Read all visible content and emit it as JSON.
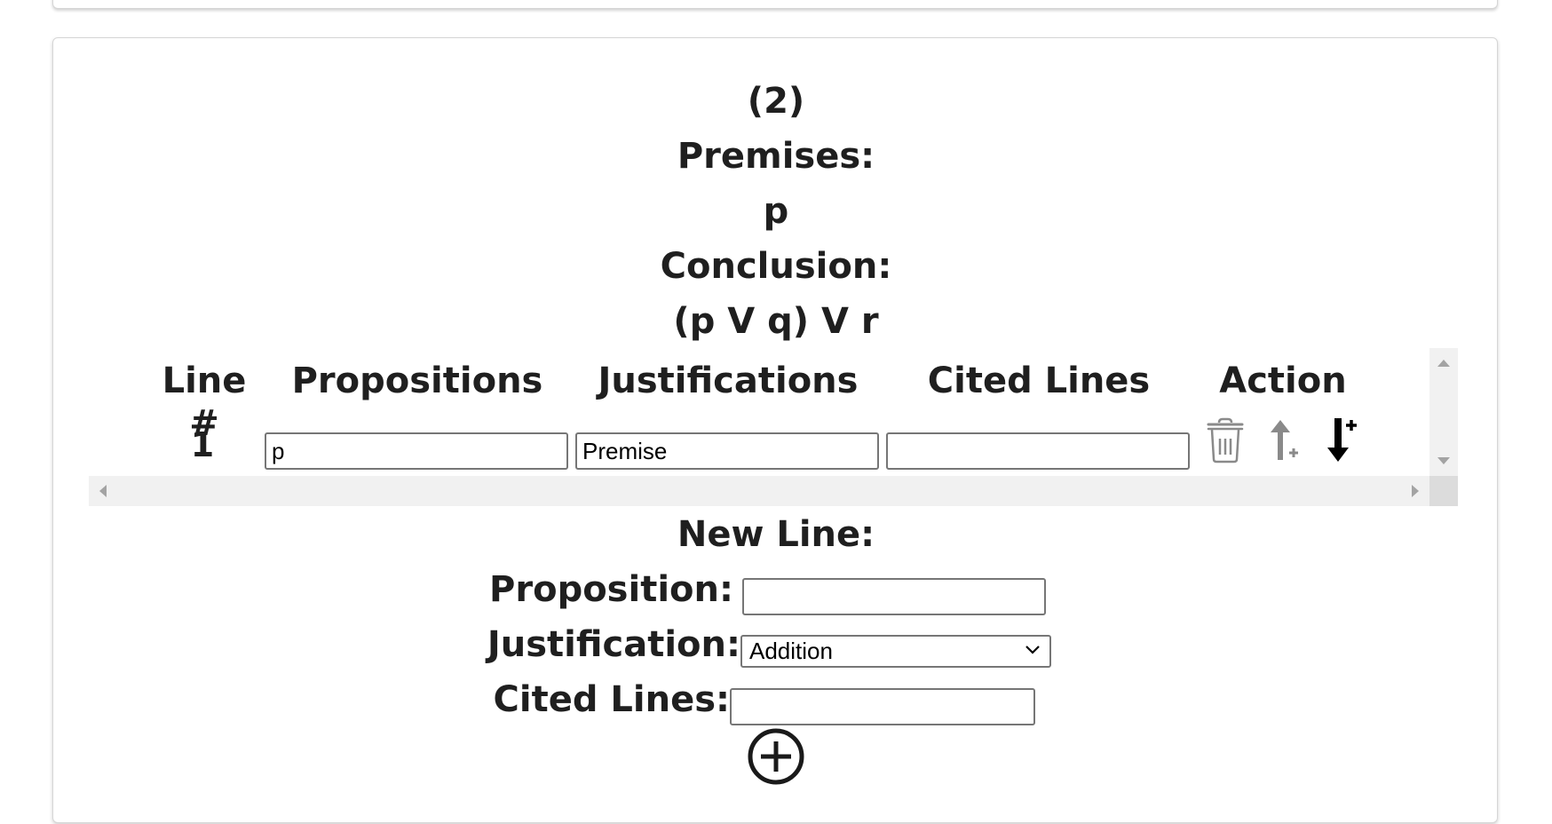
{
  "problem": {
    "number": "(2)",
    "premises_label": "Premises:",
    "premises": "p",
    "conclusion_label": "Conclusion:",
    "conclusion": "(p V q) V r"
  },
  "table": {
    "headers": [
      "Line #",
      "Propositions",
      "Justifications",
      "Cited Lines",
      "Action"
    ],
    "rows": [
      {
        "line": "1",
        "proposition": "p",
        "justification": "Premise",
        "cited_lines": ""
      }
    ]
  },
  "new_line": {
    "title": "New Line:",
    "proposition_label": "Proposition:",
    "proposition_value": "",
    "justification_label": "Justification:",
    "justification_selected": "Addition",
    "cited_lines_label": "Cited Lines:",
    "cited_lines_value": ""
  },
  "icons": {
    "delete": "trash-icon",
    "insert_above": "insert-above-icon",
    "insert_below": "insert-below-icon",
    "add": "add-circle-icon"
  },
  "colors": {
    "text": "#1f1f1f",
    "icon_gray": "#8a8a8a",
    "icon_black": "#000000",
    "scrollbar": "#f1f1f1"
  }
}
